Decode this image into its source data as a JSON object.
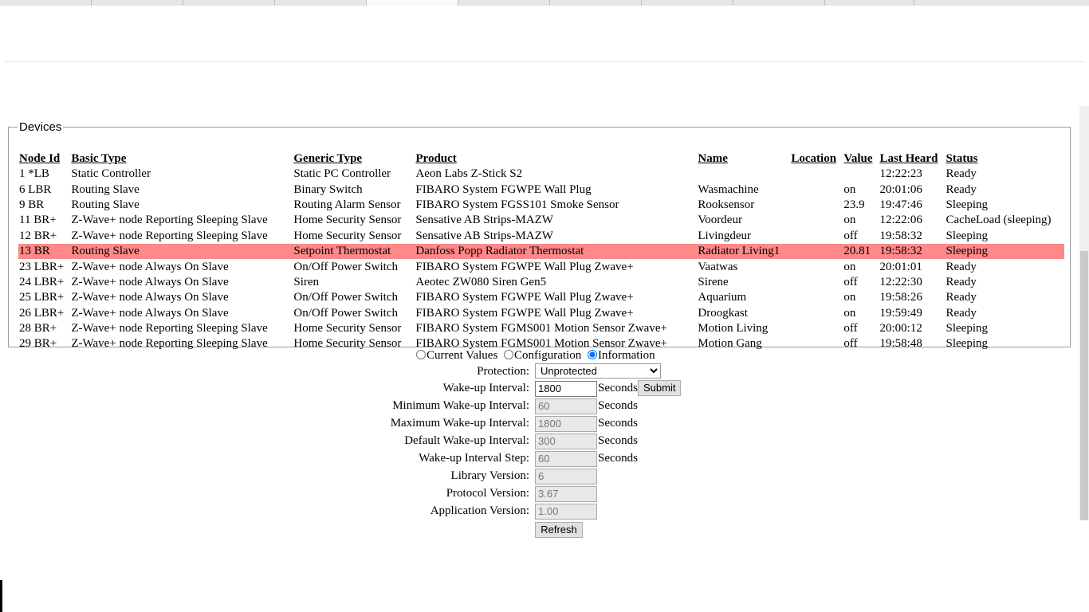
{
  "devices": {
    "legend": "Devices",
    "headers": [
      "Node Id",
      "Basic Type",
      "Generic Type",
      "Product",
      "Name",
      "Location",
      "Value",
      "Last Heard",
      "Status"
    ],
    "rows": [
      {
        "node": "1 *LB",
        "basic": "Static Controller",
        "generic": "Static PC Controller",
        "product": "Aeon Labs Z-Stick S2",
        "name": "",
        "location": "",
        "value": "",
        "heard": "12:22:23",
        "status": "Ready"
      },
      {
        "node": "6 LBR",
        "basic": "Routing Slave",
        "generic": "Binary Switch",
        "product": "FIBARO System FGWPE Wall Plug",
        "name": "Wasmachine",
        "location": "",
        "value": "on",
        "heard": "20:01:06",
        "status": "Ready"
      },
      {
        "node": "9 BR",
        "basic": "Routing Slave",
        "generic": "Routing Alarm Sensor",
        "product": "FIBARO System FGSS101 Smoke Sensor",
        "name": "Rooksensor",
        "location": "",
        "value": "23.9",
        "heard": "19:47:46",
        "status": "Sleeping"
      },
      {
        "node": "11 BR+",
        "basic": "Z-Wave+ node Reporting Sleeping Slave",
        "generic": "Home Security Sensor",
        "product": "Sensative AB Strips-MAZW",
        "name": "Voordeur",
        "location": "",
        "value": "on",
        "heard": "12:22:06",
        "status": "CacheLoad (sleeping)"
      },
      {
        "node": "12 BR+",
        "basic": "Z-Wave+ node Reporting Sleeping Slave",
        "generic": "Home Security Sensor",
        "product": "Sensative AB Strips-MAZW",
        "name": "Livingdeur",
        "location": "",
        "value": "off",
        "heard": "19:58:32",
        "status": "Sleeping"
      },
      {
        "node": "13 BR",
        "basic": "Routing Slave",
        "generic": "Setpoint Thermostat",
        "product": "Danfoss Popp Radiator Thermostat",
        "name": "Radiator Living1",
        "location": "",
        "value": "20.81",
        "heard": "19:58:32",
        "status": "Sleeping"
      },
      {
        "node": "23 LBR+",
        "basic": "Z-Wave+ node Always On Slave",
        "generic": "On/Off Power Switch",
        "product": "FIBARO System FGWPE Wall Plug Zwave+",
        "name": "Vaatwas",
        "location": "",
        "value": "on",
        "heard": "20:01:01",
        "status": "Ready"
      },
      {
        "node": "24 LBR+",
        "basic": "Z-Wave+ node Always On Slave",
        "generic": "Siren",
        "product": "Aeotec ZW080 Siren Gen5",
        "name": "Sirene",
        "location": "",
        "value": "off",
        "heard": "12:22:30",
        "status": "Ready"
      },
      {
        "node": "25 LBR+",
        "basic": "Z-Wave+ node Always On Slave",
        "generic": "On/Off Power Switch",
        "product": "FIBARO System FGWPE Wall Plug Zwave+",
        "name": "Aquarium",
        "location": "",
        "value": "on",
        "heard": "19:58:26",
        "status": "Ready"
      },
      {
        "node": "26 LBR+",
        "basic": "Z-Wave+ node Always On Slave",
        "generic": "On/Off Power Switch",
        "product": "FIBARO System FGWPE Wall Plug Zwave+",
        "name": "Droogkast",
        "location": "",
        "value": "on",
        "heard": "19:59:49",
        "status": "Ready"
      },
      {
        "node": "28 BR+",
        "basic": "Z-Wave+ node Reporting Sleeping Slave",
        "generic": "Home Security Sensor",
        "product": "FIBARO System FGMS001 Motion Sensor Zwave+",
        "name": "Motion Living",
        "location": "",
        "value": "off",
        "heard": "20:00:12",
        "status": "Sleeping"
      },
      {
        "node": "29 BR+",
        "basic": "Z-Wave+ node Reporting Sleeping Slave",
        "generic": "Home Security Sensor",
        "product": "FIBARO System FGMS001 Motion Sensor Zwave+",
        "name": "Motion Gang",
        "location": "",
        "value": "off",
        "heard": "19:58:48",
        "status": "Sleeping"
      }
    ],
    "selected_index": 5,
    "selected_color": "#ff8888"
  },
  "view": {
    "options": [
      "Current Values",
      "Configuration",
      "Information"
    ],
    "selected": "Information"
  },
  "info": {
    "protection_label": "Protection:",
    "protection_value": "Unprotected",
    "wakeup_label": "Wake-up Interval:",
    "wakeup_value": "1800",
    "seconds": "Seconds",
    "submit_label": "Submit",
    "min_label": "Minimum Wake-up Interval:",
    "min_value": "60",
    "max_label": "Maximum Wake-up Interval:",
    "max_value": "1800",
    "default_label": "Default Wake-up Interval:",
    "default_value": "300",
    "step_label": "Wake-up Interval Step:",
    "step_value": "60",
    "library_label": "Library Version:",
    "library_value": "6",
    "protocol_label": "Protocol Version:",
    "protocol_value": "3.67",
    "application_label": "Application Version:",
    "application_value": "1.00",
    "refresh_label": "Refresh"
  }
}
